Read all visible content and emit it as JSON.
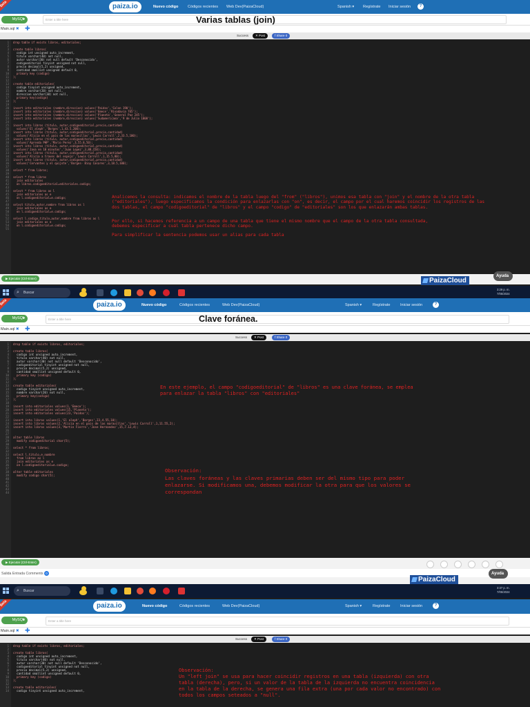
{
  "nav": {
    "logo": "paiza.io",
    "links": [
      "Nuevo código",
      "Códigos recientes",
      "Web Dev(PaizaCloud)"
    ],
    "language": "Spanish ▾",
    "register": "Regístrate",
    "login": "Iniciar sesión",
    "help_glyph": "?",
    "ribbon": "Beta"
  },
  "toolbar": {
    "lang": "MySQL",
    "lang_caret": "▾",
    "title_placeholder": "Enter a title here",
    "file_tab": "Main.sql",
    "close_glyph": "✖",
    "plus_glyph": "✚"
  },
  "social": {
    "label": "Success",
    "post": "✕ Post",
    "share": "f Share 0"
  },
  "panel1": {
    "title": "Varias tablas (join)",
    "notes": [
      "Analicemos la consulta: indicamos el nombre de la tabla luego del \"from\" (\"libros\"), unimos esa tabla con \"join\" y el nombre de la otra tabla (\"editoriales\"), luego especificamos la condición para enlazarlas con \"on\", es decir, el campo por el cual haremos coincidir los registros de las dos tablas, el campo \"codigoeditorial\" de \"libros\" y el campo \"codigo\" de \"editoriales\" son los que enlazarán ambas tablas.",
      "Por ello, si hacemos referencia a un campo de una tabla que tiene el mismo nombre que el campo de la otra tabla consultada, debemos especificar a cuál tabla pertenece dicho campo.",
      "Para simplificar la sentencia podemos usar un alias para cada tabla"
    ],
    "run_label": "▶ Ejecutar (Ctrl-Enter)",
    "help_label": "Ayuda",
    "cloud_label": "PaizaCloud",
    "time": "3:29 p. m.",
    "date": "7/05/2024",
    "search": "Buscar",
    "code": [
      "drop table if exists libros, editoriales;",
      "",
      "create table libros(",
      "  codigo int unsigned auto_increment,",
      "  titulo varchar(40) not null,",
      "  autor varchar(30) not null default 'Desconocido',",
      "  codigoeditorial tinyint unsigned not null,",
      "  precio decimal(5,2) unsigned,",
      "  cantidad smallint unsigned default 0,",
      "  primary key (codigo)",
      ");",
      "",
      "create table editoriales(",
      "  codigo tinyint unsigned auto_increment,",
      "  nombre varchar(20) not null,",
      "  direccion varchar(30) not null,",
      "  primary key(codigo)",
      ");",
      "",
      "insert into editoriales (nombre,direccion) values('Paidos','Colon 190');",
      "insert into editoriales (nombre,direccion) values('Emece','Rivadavia 765');",
      "insert into editoriales (nombre,direccion) values('Planeta','General Paz 245');",
      "insert into editoriales (nombre,direccion) values('Sudamericana','9 de Julio 1008');",
      "",
      "insert into libros (titulo, autor,codigoeditorial,precio,cantidad)",
      "  values('El aleph','Borges',1,43.5,200);",
      "insert into libros (titulo, autor,codigoeditorial,precio,cantidad)",
      "  values('Alicia en el pais de las maravillas','Lewis Carroll',2,33.5,100);",
      "insert into libros (titulo, autor,codigoeditorial,precio,cantidad)",
      "  values('Aprenda PHP','Mario Perez',3,55.8,50);",
      "insert into libros (titulo, autor,codigoeditorial,precio,cantidad)",
      "  values('Java en 10 minutos','Juan Lopez',3,88,150);",
      "insert into libros (titulo, autor,codigoeditorial,precio,cantidad)",
      "  values('Alicia a traves del espejo','Lewis Carroll',1,15.5,80);",
      "insert into libros (titulo, autor,codigoeditorial,precio,cantidad)",
      "  values('Cervantes y el quijote','Borges- Bioy Casares',3,18.5,100);",
      "",
      "select * from libros;",
      "",
      "select * from libros",
      "  join editoriales",
      "  on libros.codigoeditorial=editoriales.codigo;",
      "",
      "select * from libros as l",
      "  join editoriales as e",
      "  on l.codigoeditorial=e.codigo;",
      "",
      "select titulo,autor,nombre from libros as l",
      "  join editoriales as e",
      "  on l.codigoeditorial=e.codigo;",
      "",
      "select l.codigo,titulo,autor,nombre from libros as l",
      "  join editoriales as e",
      "  on l.codigoeditorial=e.codigo;",
      ""
    ]
  },
  "panel2": {
    "title": "Clave foránea.",
    "notes": [
      "En este ejemplo, el campo \"codigoeditorial\" de \"libros\" es una clave foránea, se emplea para enlazar la tabla \"libros\" con \"editoriales\"",
      "Observación:",
      "Las claves foráneas y las claves primarias deben ser del mismo tipo para poder enlazarse. Si modificamos una, debemos modificar la otra para que los valores se correspondan"
    ],
    "run_label": "▶ Ejecutar (Ctrl-Enter)",
    "help_label": "Ayuda",
    "cloud_label": "PaizaCloud",
    "output_tabs": [
      "Salida",
      "Entrada",
      "Comments"
    ],
    "comments_count": "0",
    "time": "3:37 p. m.",
    "date": "7/05/2024",
    "search": "Buscar",
    "code": [
      "drop table if exists libros, editoriales;",
      "",
      "create table libros(",
      "  codigo int unsigned auto_increment,",
      "  titulo varchar(40) not null,",
      "  autor varchar(30) not null default 'Desconocido',",
      "  codigoeditorial tinyint unsigned not null,",
      "  precio decimal(5,2) unsigned,",
      "  cantidad smallint unsigned default 0,",
      "  primary key (codigo)",
      ");",
      "",
      "create table editoriales(",
      "  codigo tinyint unsigned auto_increment,",
      "  nombre varchar(20) not null,",
      "  primary key(codigo)",
      ");",
      "",
      "insert into editoriales values(1,'Emece');",
      "insert into editoriales values(15,'Planeta');",
      "insert into editoriales values(23,'Paidos');",
      "",
      "insert into libros values(1,'El aleph','Borges',23,4.55,10);",
      "insert into libros values(2,'Alicia en el pais de las maravillas','Lewis Carroll',1,11.55,2);",
      "insert into libros values(3,'Martin Fierro','Jose Hernandez',15,7.12,4);",
      "",
      "",
      "alter table libros",
      "  modify codigoeditorial char(5);",
      "",
      "select * from libros;",
      "",
      "select l.titulo,e.nombre",
      "  from libros as l",
      "  join editoriales as e",
      "  on l.codigoeditorial=e.codigo;",
      "",
      "alter table editoriales",
      "  modify codigo char(5);",
      "",
      "",
      "",
      "",
      ""
    ]
  },
  "panel3": {
    "notes": [
      "Observación:",
      "Un \"left join\" se usa para hacer coincidir registros en una tabla (izquierda) con otra tabla (derecha), pero, si un valor de la tabla de la izquierda no encuentra coincidencia en la tabla de la derecha, se genera una fila extra (una por cada valor no encontrado) con todos los campos seteados a \"null\"."
    ],
    "code": [
      "drop table if exists libros, editoriales;",
      "",
      "create table libros(",
      "  codigo int unsigned auto_increment,",
      "  titulo varchar(40) not null,",
      "  autor varchar(30) not null default 'Desconocido',",
      "  codigoeditorial tinyint unsigned not null,",
      "  precio decimal(5,2) unsigned,",
      "  cantidad smallint unsigned default 0,",
      "  primary key (codigo)",
      ");",
      "",
      "create table editoriales(",
      "  codigo tinyint unsigned auto_increment,"
    ]
  },
  "colors": {
    "nav": "#1f6fb5",
    "note": "#e02222",
    "mysql_badge": "#4ea14e",
    "taskbar": "#0d1a33",
    "cloud": "#1f4f99"
  }
}
